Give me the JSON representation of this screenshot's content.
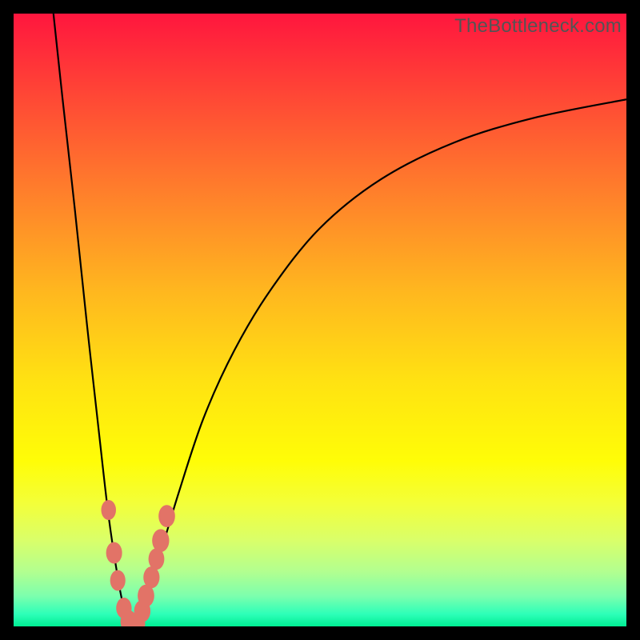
{
  "watermark": {
    "text": "TheBottleneck.com"
  },
  "colors": {
    "frame_bg": "#000000",
    "curve_stroke": "#000000",
    "marker_fill": "#e27367",
    "marker_stroke": "#c25a4f"
  },
  "chart_data": {
    "type": "line",
    "title": "",
    "xlabel": "",
    "ylabel": "",
    "xlim": [
      0,
      100
    ],
    "ylim": [
      0,
      100
    ],
    "note": "y = bottleneck percentage (0 at bottom, 100 at top). x in arbitrary 0–100 units. Values estimated from pixel positions.",
    "series": [
      {
        "name": "bottleneck-curve",
        "x": [
          6.5,
          8,
          10,
          12,
          14,
          15.5,
          17,
          18,
          19,
          19.7,
          20.5,
          22,
          24,
          27,
          31,
          36,
          42,
          50,
          60,
          72,
          85,
          100
        ],
        "y": [
          100,
          86,
          68,
          49,
          31,
          18,
          8,
          3,
          0.5,
          0,
          1,
          5,
          12,
          22,
          34,
          45,
          55,
          65,
          73,
          79,
          83,
          86
        ]
      }
    ],
    "markers": {
      "name": "highlighted-points",
      "x": [
        15.5,
        16.4,
        17.0,
        18.0,
        18.8,
        19.5,
        20.2,
        21.0,
        21.6,
        22.5,
        23.3,
        24.0,
        25.0
      ],
      "y": [
        19.0,
        12.0,
        7.5,
        3.0,
        0.8,
        0.0,
        0.5,
        2.5,
        5.0,
        8.0,
        11.0,
        14.0,
        18.0
      ]
    }
  }
}
